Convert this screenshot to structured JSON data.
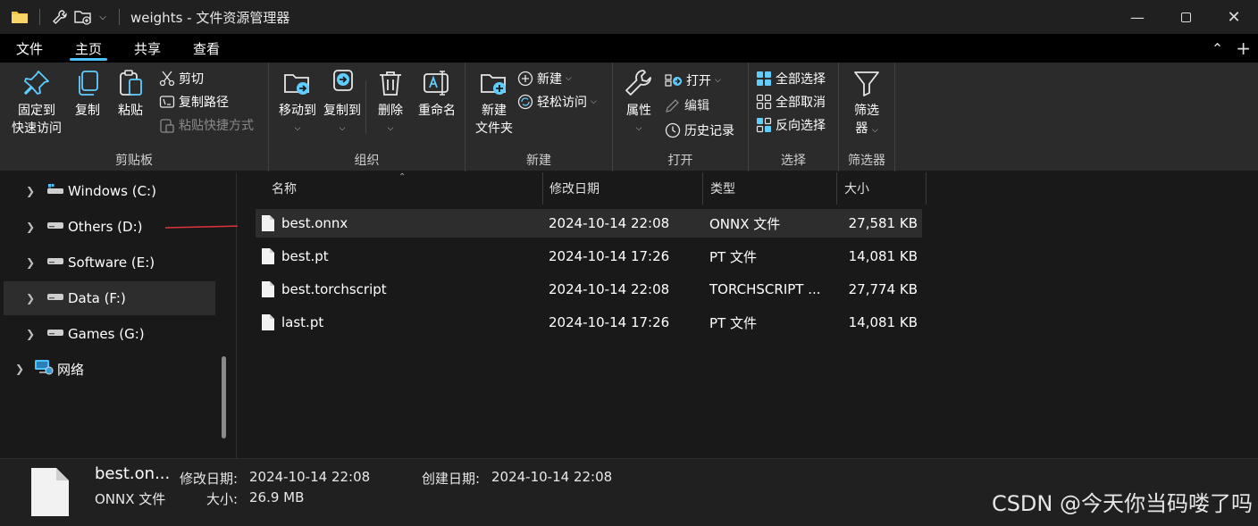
{
  "window": {
    "title": "weights - 文件资源管理器",
    "min_icon": "minimize-icon",
    "max_icon": "maximize-icon",
    "close_icon": "close-icon"
  },
  "menu": {
    "tabs": [
      "文件",
      "主页",
      "共享",
      "查看"
    ],
    "active": "主页"
  },
  "ribbon": {
    "clipboard": {
      "label": "剪贴板",
      "pin_line1": "固定到",
      "pin_line2": "快速访问",
      "copy": "复制",
      "paste": "粘贴",
      "cut": "剪切",
      "copy_path": "复制路径",
      "paste_shortcut": "粘贴快捷方式"
    },
    "organize": {
      "label": "组织",
      "move_to": "移动到",
      "copy_to": "复制到",
      "delete": "删除",
      "rename": "重命名"
    },
    "new": {
      "label": "新建",
      "new_folder_line1": "新建",
      "new_folder_line2": "文件夹",
      "new_item": "新建",
      "easy_access": "轻松访问"
    },
    "open": {
      "label": "打开",
      "properties": "属性",
      "open": "打开",
      "edit": "编辑",
      "history": "历史记录"
    },
    "select": {
      "label": "选择",
      "select_all": "全部选择",
      "select_none": "全部取消",
      "invert": "反向选择"
    },
    "filter": {
      "label": "筛选器",
      "btn_line1": "筛选",
      "btn_line2": "器"
    }
  },
  "nav": {
    "items": [
      {
        "label": "Windows (C:)"
      },
      {
        "label": "Others (D:)"
      },
      {
        "label": "Software (E:)"
      },
      {
        "label": "Data (F:)"
      },
      {
        "label": "Games (G:)"
      },
      {
        "label": "网络"
      }
    ],
    "selected_index": 3
  },
  "columns": {
    "name": "名称",
    "modified": "修改日期",
    "type": "类型",
    "size": "大小"
  },
  "files": [
    {
      "name": "best.onnx",
      "modified": "2024-10-14 22:08",
      "type": "ONNX 文件",
      "size": "27,581 KB"
    },
    {
      "name": "best.pt",
      "modified": "2024-10-14 17:26",
      "type": "PT 文件",
      "size": "14,081 KB"
    },
    {
      "name": "best.torchscript",
      "modified": "2024-10-14 22:08",
      "type": "TORCHSCRIPT ...",
      "size": "27,774 KB"
    },
    {
      "name": "last.pt",
      "modified": "2024-10-14 17:26",
      "type": "PT 文件",
      "size": "14,081 KB"
    }
  ],
  "details": {
    "name": "best.on...",
    "type": "ONNX 文件",
    "modified_label": "修改日期:",
    "modified_value": "2024-10-14 22:08",
    "size_label": "大小:",
    "size_value": "26.9 MB",
    "created_label": "创建日期:",
    "created_value": "2024-10-14 22:08"
  },
  "watermark": "CSDN @今天你当码喽了吗",
  "colors": {
    "accent": "#4cc2ff",
    "annotation_arrow": "#e0323c",
    "folder": "#f4c542"
  }
}
